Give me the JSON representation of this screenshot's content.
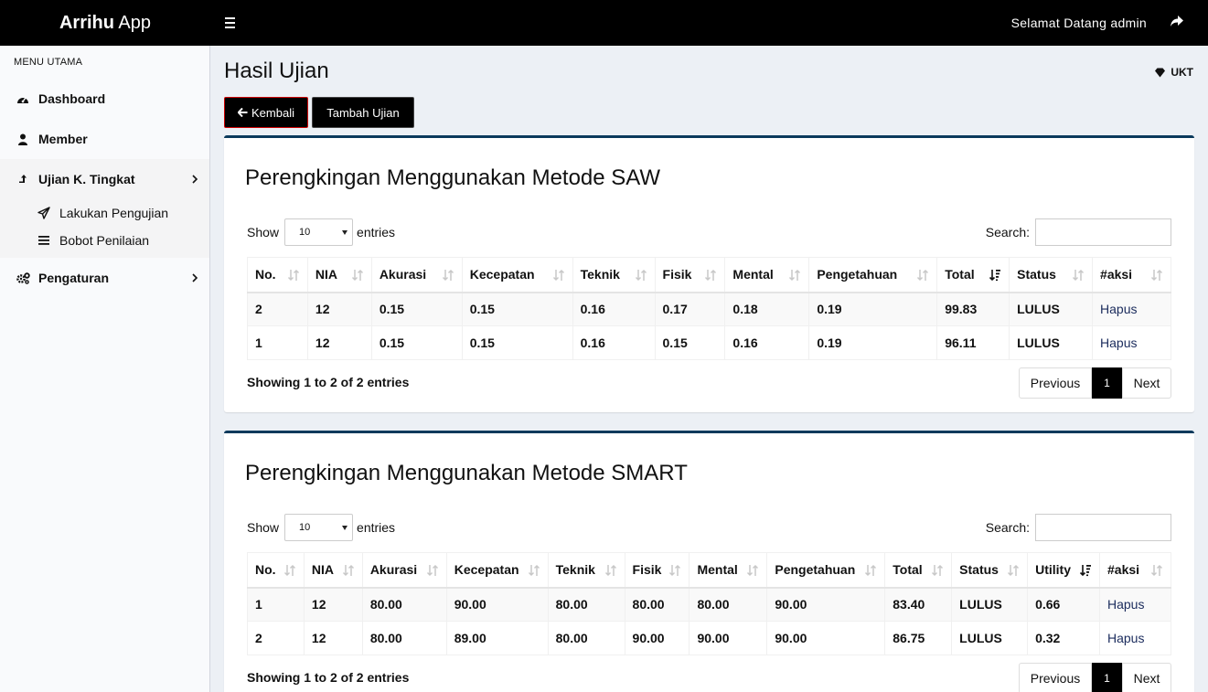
{
  "app": {
    "brand_bold": "Arrihu",
    "brand_rest": " App",
    "greeting": "Selamat Datang  admin"
  },
  "sidebar": {
    "header": "MENU UTAMA",
    "items": [
      {
        "label": "Dashboard",
        "icon": "dashboard-icon"
      },
      {
        "label": "Member",
        "icon": "user-icon"
      },
      {
        "label": "Ujian K. Tingkat",
        "icon": "level-up-icon"
      },
      {
        "label": "Pengaturan",
        "icon": "gears-icon"
      }
    ],
    "subitems": [
      {
        "label": "Lakukan Pengujian",
        "icon": "paper-plane-icon"
      },
      {
        "label": "Bobot Penilaian",
        "icon": "list-icon"
      }
    ]
  },
  "page": {
    "title": "Hasil Ujian",
    "breadcrumb": "UKT",
    "back_button": "Kembali",
    "add_button": "Tambah Ujian"
  },
  "saw": {
    "title": "Perengkingan Menggunakan Metode SAW",
    "show_label": "Show",
    "entries_label": "entries",
    "page_length": "10",
    "search_label": "Search:",
    "headers": [
      "No.",
      "NIA",
      "Akurasi",
      "Kecepatan",
      "Teknik",
      "Fisik",
      "Mental",
      "Pengetahuan",
      "Total",
      "Status",
      "#aksi"
    ],
    "rows": [
      [
        "2",
        "12",
        "0.15",
        "0.15",
        "0.16",
        "0.17",
        "0.18",
        "0.19",
        "99.83",
        "LULUS",
        "Hapus"
      ],
      [
        "1",
        "12",
        "0.15",
        "0.15",
        "0.16",
        "0.15",
        "0.16",
        "0.19",
        "96.11",
        "LULUS",
        "Hapus"
      ]
    ],
    "info": "Showing 1 to 2 of 2 entries",
    "prev": "Previous",
    "current_page": "1",
    "next": "Next"
  },
  "smart": {
    "title": "Perengkingan Menggunakan Metode SMART",
    "show_label": "Show",
    "entries_label": "entries",
    "page_length": "10",
    "search_label": "Search:",
    "headers": [
      "No.",
      "NIA",
      "Akurasi",
      "Kecepatan",
      "Teknik",
      "Fisik",
      "Mental",
      "Pengetahuan",
      "Total",
      "Status",
      "Utility",
      "#aksi"
    ],
    "rows": [
      [
        "1",
        "12",
        "80.00",
        "90.00",
        "80.00",
        "80.00",
        "80.00",
        "90.00",
        "83.40",
        "LULUS",
        "0.66",
        "Hapus"
      ],
      [
        "2",
        "12",
        "80.00",
        "89.00",
        "80.00",
        "90.00",
        "90.00",
        "90.00",
        "86.75",
        "LULUS",
        "0.32",
        "Hapus"
      ]
    ],
    "info": "Showing 1 to 2 of 2 entries",
    "prev": "Previous",
    "current_page": "1",
    "next": "Next"
  }
}
